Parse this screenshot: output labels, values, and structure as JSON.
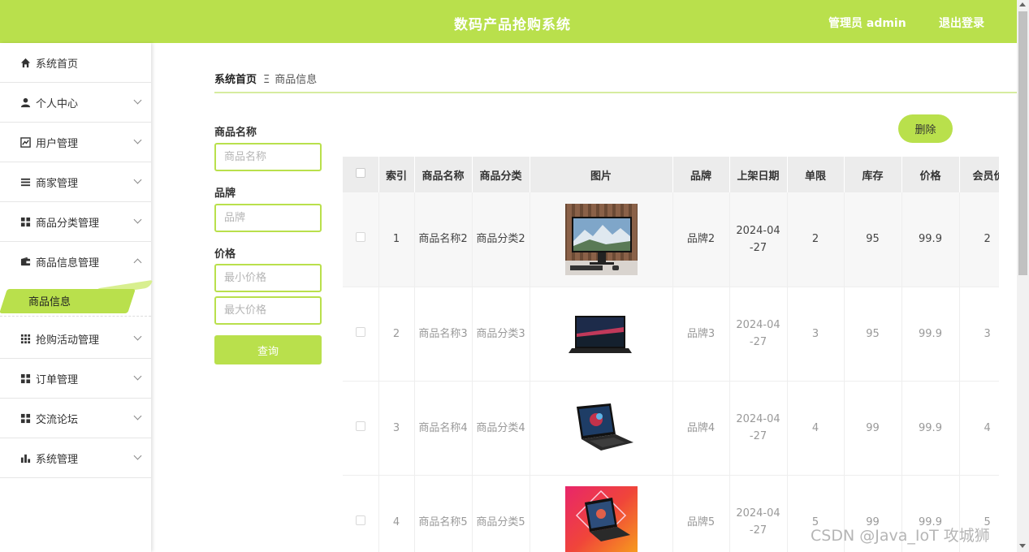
{
  "header": {
    "title": "数码产品抢购系统",
    "admin_label": "管理员 admin",
    "logout_label": "退出登录"
  },
  "sidebar": {
    "items": [
      {
        "label": "系统首页",
        "icon": "home-icon"
      },
      {
        "label": "个人中心",
        "icon": "user-icon"
      },
      {
        "label": "用户管理",
        "icon": "chart-line-icon"
      },
      {
        "label": "商家管理",
        "icon": "list-icon"
      },
      {
        "label": "商品分类管理",
        "icon": "grid-icon"
      },
      {
        "label": "商品信息管理",
        "icon": "wallet-icon"
      },
      {
        "label": "抢购活动管理",
        "icon": "apps-icon"
      },
      {
        "label": "订单管理",
        "icon": "grid-icon"
      },
      {
        "label": "交流论坛",
        "icon": "grid-icon"
      },
      {
        "label": "系统管理",
        "icon": "bar-chart-icon"
      }
    ],
    "active_sub": "商品信息"
  },
  "breadcrumb": {
    "home": "系统首页",
    "separator": "Ξ",
    "current": "商品信息"
  },
  "search": {
    "name_label": "商品名称",
    "name_placeholder": "商品名称",
    "brand_label": "品牌",
    "brand_placeholder": "品牌",
    "price_label": "价格",
    "min_placeholder": "最小价格",
    "max_placeholder": "最大价格",
    "query_button": "查询"
  },
  "delete_button": "删除",
  "table": {
    "headers": [
      "",
      "索引",
      "商品名称",
      "商品分类",
      "图片",
      "品牌",
      "上架日期",
      "单限",
      "库存",
      "价格",
      "会员价"
    ],
    "rows": [
      {
        "index": "1",
        "name": "商品名称2",
        "category": "商品分类2",
        "image": "monitor-image",
        "brand": "品牌2",
        "date": "2024-04-27",
        "limit": "2",
        "stock": "95",
        "price": "99.9",
        "member_price": "2"
      },
      {
        "index": "2",
        "name": "商品名称3",
        "category": "商品分类3",
        "image": "laptop-image",
        "brand": "品牌3",
        "date": "2024-04-27",
        "limit": "3",
        "stock": "95",
        "price": "99.9",
        "member_price": "3"
      },
      {
        "index": "3",
        "name": "商品名称4",
        "category": "商品分类4",
        "image": "gaming-laptop-image",
        "brand": "品牌4",
        "date": "2024-04-27",
        "limit": "4",
        "stock": "99",
        "price": "99.9",
        "member_price": "4"
      },
      {
        "index": "4",
        "name": "商品名称5",
        "category": "商品分类5",
        "image": "laptop-promo-image",
        "brand": "品牌5",
        "date": "2024-04-27",
        "limit": "5",
        "stock": "99",
        "price": "99.9",
        "member_price": "5"
      }
    ]
  },
  "watermark": "CSDN @Java_IoT 攻城狮",
  "colors": {
    "accent": "#b9e04c"
  }
}
